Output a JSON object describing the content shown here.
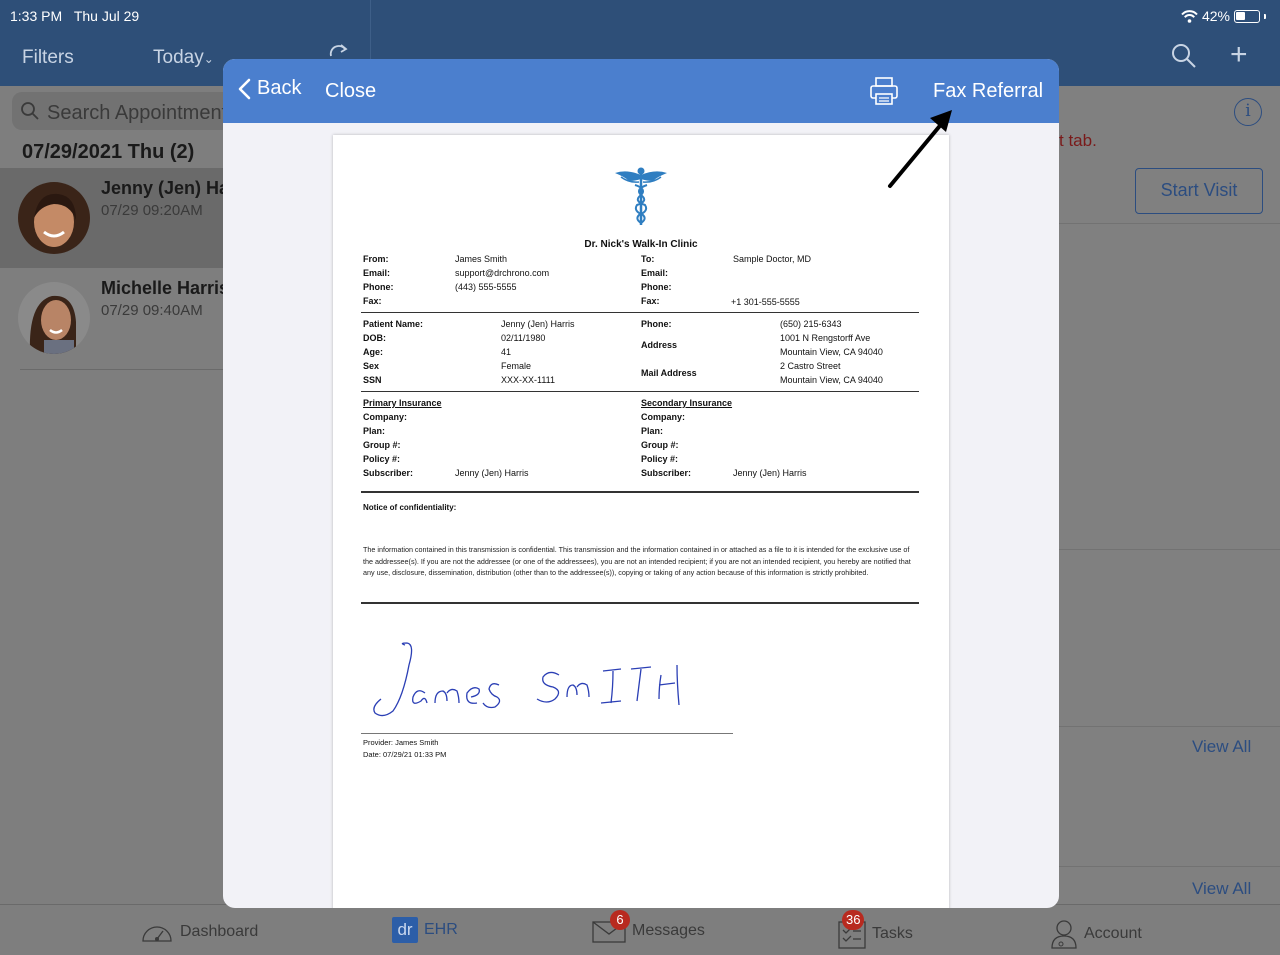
{
  "status_bar": {
    "time": "1:33 PM",
    "date": "Thu Jul 29",
    "battery": "42%"
  },
  "top_nav": {
    "filters": "Filters",
    "today": "Today"
  },
  "left_panel": {
    "search_placeholder": "Search Appointments",
    "date_header": "07/29/2021 Thu (2)",
    "appointments": [
      {
        "name": "Jenny (Jen) Harris",
        "time": "07/29 09:20AM"
      },
      {
        "name": "Michelle Harris",
        "time": "07/29 09:40AM"
      }
    ]
  },
  "right_panel": {
    "tab_text": "t tab.",
    "start_visit": "Start Visit",
    "view_all_1": "View All",
    "view_all_2": "View All"
  },
  "tab_bar": {
    "dashboard": "Dashboard",
    "ehr_icon": "dr",
    "ehr": "EHR",
    "messages": "Messages",
    "messages_badge": "6",
    "tasks": "Tasks",
    "tasks_badge": "36",
    "account": "Account"
  },
  "modal": {
    "back": "Back",
    "close": "Close",
    "fax_referral": "Fax Referral"
  },
  "document": {
    "clinic_name": "Dr. Nick's Walk-In Clinic",
    "from_label": "From:",
    "from": "James Smith",
    "email_label": "Email:",
    "email": "support@drchrono.com",
    "phone_label": "Phone:",
    "phone": "(443) 555-5555",
    "fax_label": "Fax:",
    "to_label": "To:",
    "to": "Sample Doctor, MD",
    "to_email_label": "Email:",
    "to_phone_label": "Phone:",
    "to_fax_label": "Fax:",
    "to_fax": "+1 301-555-5555",
    "patient_name_label": "Patient Name:",
    "patient_name": "Jenny (Jen) Harris",
    "dob_label": "DOB:",
    "dob": "02/11/1980",
    "age_label": "Age:",
    "age": "41",
    "sex_label": "Sex",
    "sex": "Female",
    "ssn_label": "SSN",
    "ssn": "XXX-XX-1111",
    "pt_phone_label": "Phone:",
    "pt_phone": "(650) 215-6343",
    "address_label": "Address",
    "address_1": "1001 N Rengstorff Ave",
    "address_2": "Mountain View, CA 94040",
    "mail_label": "Mail Address",
    "mail_1": "2 Castro Street",
    "mail_2": "Mountain View, CA 94040",
    "primary_ins": "Primary Insurance",
    "secondary_ins": "Secondary Insurance",
    "company_label": "Company:",
    "plan_label": "Plan:",
    "group_label": "Group #:",
    "policy_label": "Policy #:",
    "subscriber_label": "Subscriber:",
    "subscriber": "Jenny (Jen) Harris",
    "notice_title": "Notice of confidentiality:",
    "notice_text": "The information contained in this transmission is confidential. This transmission and the information contained in or attached as a file to it is intended for the exclusive use of the addressee(s). If you are not the addressee (or one of the addressees), you are not an intended recipient; if you are not an intended recipient, you hereby are notified that any use, disclosure, dissemination, distribution (other than to the addressee(s)), copying or taking of any action because of this information is strictly prohibited.",
    "signature": "James Smith",
    "provider": "Provider: James Smith",
    "date": "Date: 07/29/21 01:33 PM"
  }
}
